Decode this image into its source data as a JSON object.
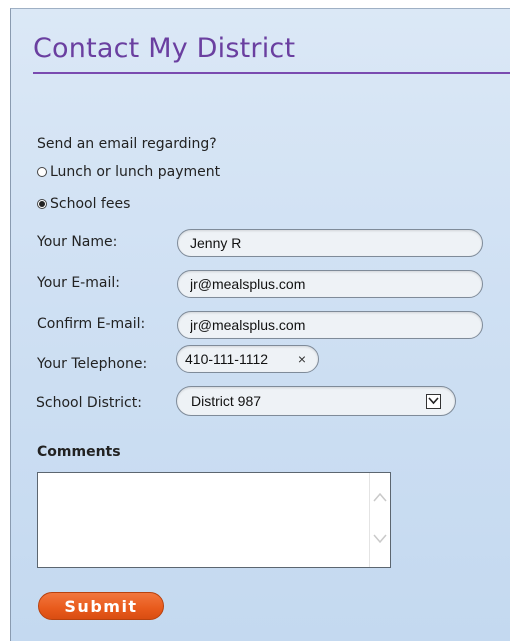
{
  "form": {
    "title": "Contact My District",
    "email_regarding_prompt": "Send an email regarding?",
    "options": [
      {
        "label": "Lunch or lunch payment",
        "selected": false
      },
      {
        "label": "School fees",
        "selected": true
      }
    ],
    "fields": {
      "name": {
        "label": "Your Name:",
        "value": "Jenny R"
      },
      "email": {
        "label": "Your E-mail:",
        "value": "jr@mealsplus.com"
      },
      "confirm_email": {
        "label": "Confirm E-mail:",
        "value": "jr@mealsplus.com"
      },
      "telephone": {
        "label": "Your Telephone:",
        "value": "410-111-1112",
        "clear_label": "×"
      },
      "district": {
        "label": "School District:",
        "selected": "District 987"
      }
    },
    "comments": {
      "label": "Comments",
      "value": ""
    },
    "submit_label": "Submit"
  },
  "colors": {
    "title": "#6a3fa0",
    "panel_bg": "#cfe0f3",
    "submit_bg": "#e85a1c"
  },
  "icons": {
    "radio_unselected": "radio-empty-icon",
    "radio_selected": "radio-filled-icon",
    "dropdown": "chevron-down-icon",
    "clear": "close-icon",
    "scroll_up": "chevron-up-icon",
    "scroll_down": "chevron-down-icon"
  }
}
